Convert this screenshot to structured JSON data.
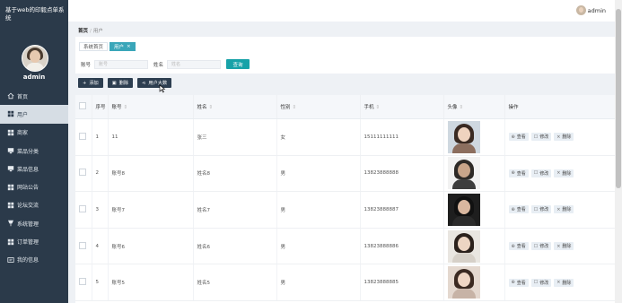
{
  "app": {
    "title": "基于web的印毅点单系统"
  },
  "user": {
    "name": "admin"
  },
  "sidebar": {
    "items": [
      {
        "label": "首页",
        "icon": "home-icon",
        "active": false
      },
      {
        "label": "用户",
        "icon": "grid-icon",
        "active": true
      },
      {
        "label": "商家",
        "icon": "grid-icon",
        "active": false
      },
      {
        "label": "菜品分类",
        "icon": "monitor-icon",
        "active": false
      },
      {
        "label": "菜品信息",
        "icon": "monitor-icon",
        "active": false
      },
      {
        "label": "网站公告",
        "icon": "grid-icon",
        "active": false
      },
      {
        "label": "论坛交流",
        "icon": "grid-icon",
        "active": false
      },
      {
        "label": "系统管理",
        "icon": "pin-icon",
        "active": false
      },
      {
        "label": "订单管理",
        "icon": "grid-icon",
        "active": false
      },
      {
        "label": "我的信息",
        "icon": "card-icon",
        "active": false
      }
    ]
  },
  "topbar": {
    "username": "admin"
  },
  "breadcrumb": {
    "home": "首页",
    "current": "用户"
  },
  "tabs": [
    {
      "label": "系统首页"
    },
    {
      "label": "用户",
      "close": "×"
    }
  ],
  "search": {
    "account_label": "账号",
    "account_placeholder": "账号",
    "name_label": "姓名",
    "name_placeholder": "姓名",
    "button": "查询"
  },
  "actions": {
    "add": "添加",
    "delete": "删除",
    "export": "用户大数"
  },
  "table": {
    "headers": [
      "序号",
      "账号",
      "姓名",
      "性别",
      "手机",
      "头像",
      "操作"
    ],
    "op_labels": {
      "view": "查看",
      "edit": "修改",
      "delete": "删除"
    },
    "rows": [
      {
        "index": "1",
        "account": "11",
        "name": "张三",
        "gender": "女",
        "phone": "15111111111"
      },
      {
        "index": "2",
        "account": "账号8",
        "name": "姓名8",
        "gender": "男",
        "phone": "13823888888"
      },
      {
        "index": "3",
        "account": "账号7",
        "name": "姓名7",
        "gender": "男",
        "phone": "13823888887"
      },
      {
        "index": "4",
        "account": "账号6",
        "name": "姓名6",
        "gender": "男",
        "phone": "13823888886"
      },
      {
        "index": "5",
        "account": "账号5",
        "name": "姓名5",
        "gender": "男",
        "phone": "13823888885"
      }
    ]
  },
  "colors": {
    "sidebar": "#2b3a4a",
    "accent": "#17a2a8",
    "action_button": "#2d3e50"
  }
}
